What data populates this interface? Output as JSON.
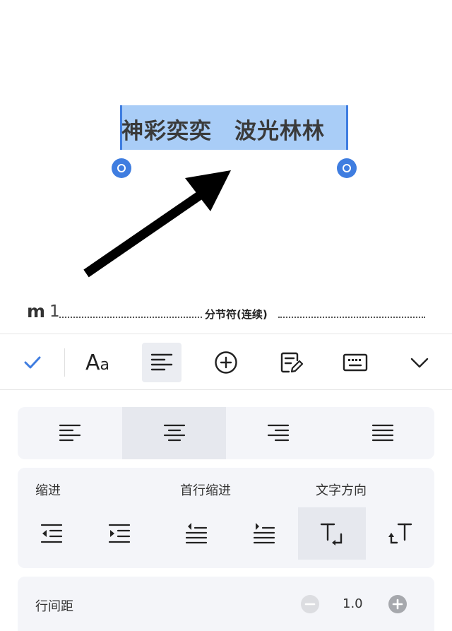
{
  "document": {
    "selected_text": "神彩奕奕　波光林林",
    "section_mark": "m",
    "section_number": "1",
    "section_break_label": "分节符(连续)"
  },
  "toolbar": {
    "items": [
      {
        "name": "confirm",
        "icon": "check-icon"
      },
      {
        "name": "font",
        "icon": "font-aa-icon",
        "label_big": "A",
        "label_small": "a"
      },
      {
        "name": "paragraph",
        "icon": "paragraph-align-icon",
        "active": true
      },
      {
        "name": "insert",
        "icon": "plus-circle-icon"
      },
      {
        "name": "review",
        "icon": "edit-note-icon"
      },
      {
        "name": "keyboard",
        "icon": "keyboard-icon"
      },
      {
        "name": "collapse",
        "icon": "chevron-down-icon"
      }
    ]
  },
  "paragraph_panel": {
    "alignment": {
      "options": [
        "align-left",
        "align-center",
        "align-right",
        "align-justify"
      ],
      "selected": "align-center"
    },
    "indent": {
      "label": "缩进",
      "first_line_label": "首行缩进",
      "direction_label": "文字方向",
      "options": [
        "decrease-indent",
        "increase-indent",
        "first-line-decrease",
        "first-line-increase",
        "text-horizontal",
        "text-vertical"
      ],
      "selected": "text-horizontal"
    },
    "line_spacing": {
      "label": "行间距",
      "value": "1.0"
    }
  },
  "colors": {
    "accent": "#3f7de0",
    "selection": "#a9cdf7",
    "panel_card": "#f4f5f9",
    "active_bg": "#e6e8ee"
  }
}
